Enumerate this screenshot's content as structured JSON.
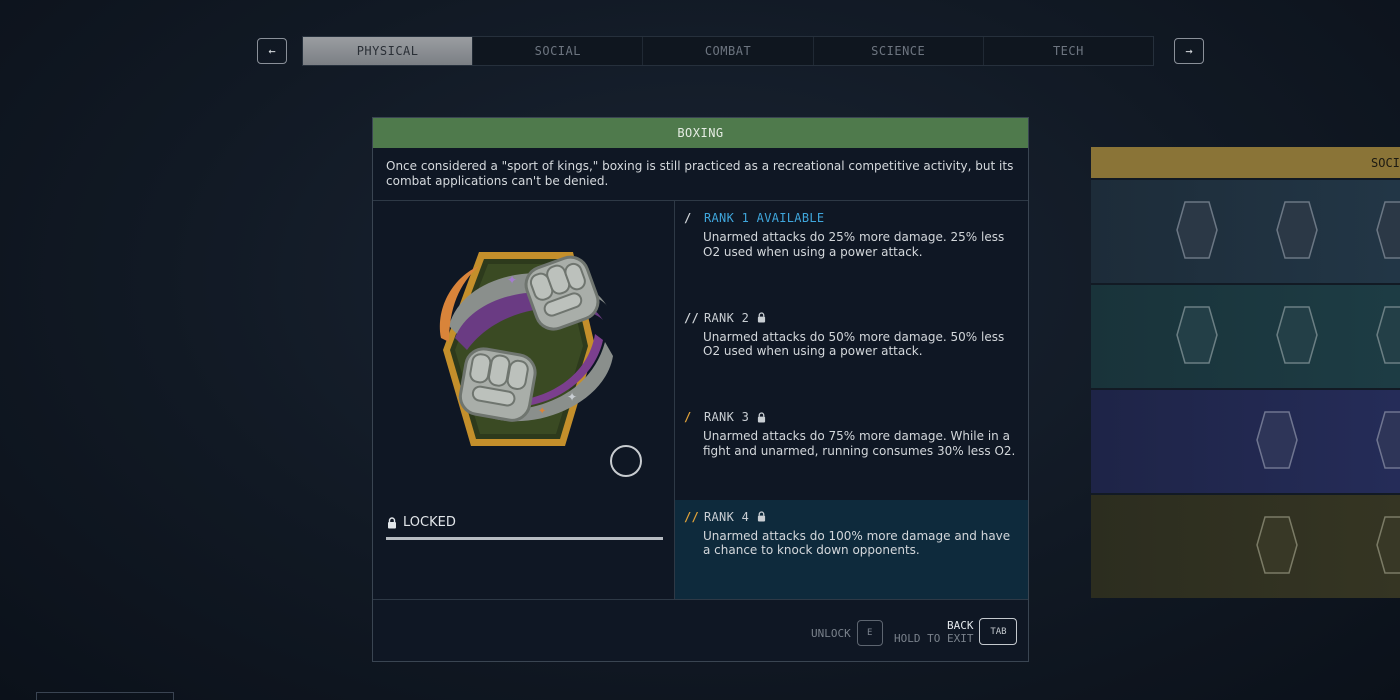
{
  "nav": {
    "prev_icon": "←",
    "next_icon": "→",
    "tabs": [
      "PHYSICAL",
      "SOCIAL",
      "COMBAT",
      "SCIENCE",
      "TECH"
    ],
    "active_tab": "PHYSICAL"
  },
  "skill": {
    "title": "BOXING",
    "description": "Once considered a \"sport of kings,\" boxing is still practiced as a recreational competitive activity, but its combat applications can't be denied.",
    "status": "LOCKED",
    "ranks": [
      {
        "pips": "/",
        "title": "RANK 1 AVAILABLE",
        "locked": false,
        "desc": "Unarmed attacks do 25% more damage. 25% less O2 used when using a power attack."
      },
      {
        "pips": "//",
        "title": "RANK 2",
        "locked": true,
        "desc": "Unarmed attacks do 50% more damage. 50% less O2 used when using a power attack."
      },
      {
        "pips": "/",
        "title": "RANK 3",
        "locked": true,
        "desc": "Unarmed attacks do 75% more damage. While in a fight and unarmed, running consumes 30% less O2."
      },
      {
        "pips": "//",
        "title": "RANK 4",
        "locked": true,
        "desc": "Unarmed attacks do 100% more damage and have a chance to knock down opponents."
      }
    ]
  },
  "footer": {
    "unlock_label": "UNLOCK",
    "unlock_key": "E",
    "back_label": "BACK",
    "hold_label": "HOLD TO EXIT",
    "back_key": "TAB"
  },
  "side_panel": {
    "header": "SOCI"
  },
  "colors": {
    "header_green": "#4f7a4c",
    "available_blue": "#3fa6dc",
    "rank_gold": "#e0a23a",
    "selected_row": "#0e2a3c",
    "side_gold": "#8a7437"
  }
}
